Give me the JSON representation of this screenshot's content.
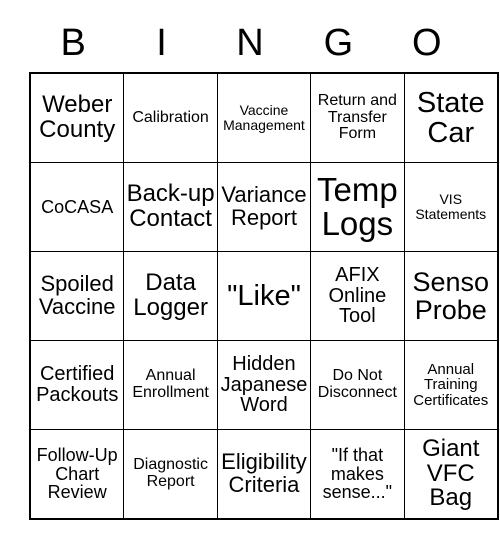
{
  "card": {
    "title": "BINGO",
    "header_letters": [
      "B",
      "I",
      "N",
      "G",
      "O"
    ],
    "colors": {
      "background": "#ffffff",
      "text": "#000000",
      "grid_line": "#000000"
    },
    "grid_size": "5x5",
    "rows": [
      [
        {
          "text": "Weber County",
          "size": "fs-xl"
        },
        {
          "text": "Calibration",
          "size": "fs-sm"
        },
        {
          "text": "Vaccine Management",
          "size": "fs-xs"
        },
        {
          "text": "Return and Transfer Form",
          "size": "fs-sm"
        },
        {
          "text": "State Car",
          "size": "fs-3xl"
        }
      ],
      [
        {
          "text": "CoCASA",
          "size": "fs-m"
        },
        {
          "text": "Back-up Contact",
          "size": "fs-xl"
        },
        {
          "text": "Variance Report",
          "size": "fs-l"
        },
        {
          "text": "Temp Logs",
          "size": "fs-4xl"
        },
        {
          "text": "VIS Statements",
          "size": "fs-xs"
        }
      ],
      [
        {
          "text": "Spoiled Vaccine",
          "size": "fs-l"
        },
        {
          "text": "Data Logger",
          "size": "fs-xl"
        },
        {
          "text": "\"Like\"",
          "size": "fs-3xl"
        },
        {
          "text": "AFIX Online Tool",
          "size": "fs-ml"
        },
        {
          "text": "Senso Probe",
          "size": "fs-2xl"
        }
      ],
      [
        {
          "text": "Certified Packouts",
          "size": "fs-ml"
        },
        {
          "text": "Annual Enrollment",
          "size": "fs-sm"
        },
        {
          "text": "Hidden Japanese Word",
          "size": "fs-ml"
        },
        {
          "text": "Do Not Disconnect",
          "size": "fs-sm"
        },
        {
          "text": "Annual Training Certificates",
          "size": "fs-s"
        }
      ],
      [
        {
          "text": "Follow-Up Chart Review",
          "size": "fs-m"
        },
        {
          "text": "Diagnostic Report",
          "size": "fs-sm"
        },
        {
          "text": "Eligibility Criteria",
          "size": "fs-l"
        },
        {
          "text": "\"If that makes sense...\"",
          "size": "fs-m"
        },
        {
          "text": "Giant VFC Bag",
          "size": "fs-xl"
        }
      ]
    ]
  }
}
